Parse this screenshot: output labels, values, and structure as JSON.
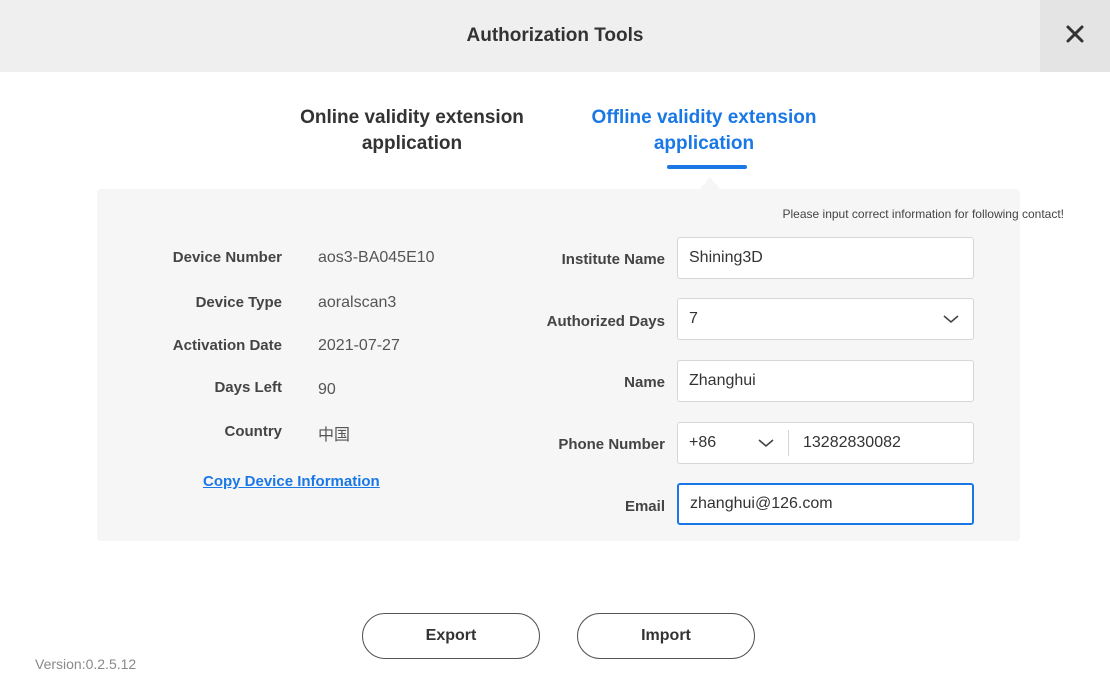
{
  "window": {
    "title": "Authorization Tools",
    "close_icon": "close-icon"
  },
  "tabs": [
    {
      "label_line1": "Online validity extension",
      "label_line2": "application",
      "active": false
    },
    {
      "label_line1": "Offline validity extension",
      "label_line2": "application",
      "active": true
    }
  ],
  "hint": "Please input correct information for following contact!",
  "device_info": {
    "device_number_label": "Device Number",
    "device_number": "aos3-BA045E10",
    "device_type_label": "Device Type",
    "device_type": "aoralscan3",
    "activation_date_label": "Activation Date",
    "activation_date": "2021-07-27",
    "days_left_label": "Days Left",
    "days_left": "90",
    "country_label": "Country",
    "country": "中国",
    "copy_link": "Copy Device Information"
  },
  "form": {
    "institute_name_label": "Institute Name",
    "institute_name": "Shining3D",
    "authorized_days_label": "Authorized Days",
    "authorized_days": "7",
    "name_label": "Name",
    "name": "Zhanghui",
    "phone_label": "Phone Number",
    "phone_code": "+86",
    "phone_number": "13282830082",
    "email_label": "Email",
    "email": "zhanghui@126.com"
  },
  "buttons": {
    "export": "Export",
    "import": "Import"
  },
  "version": "Version:0.2.5.12",
  "colors": {
    "accent": "#1a78e6",
    "panel_bg": "#f6f6f6",
    "titlebar_bg": "#efefef"
  }
}
